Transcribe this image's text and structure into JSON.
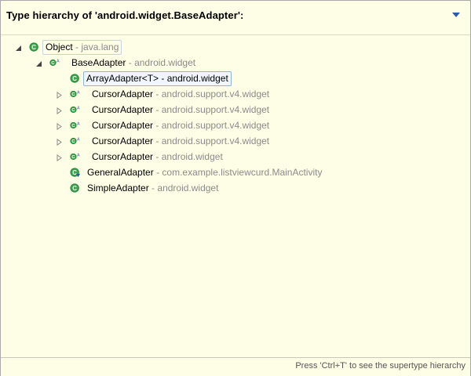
{
  "header": {
    "title": "Type hierarchy of 'android.widget.BaseAdapter':",
    "menu_icon": "chevron-down-icon"
  },
  "tree": [
    {
      "name": "Object",
      "package": "java.lang",
      "sep": " - ",
      "depth": 0,
      "twisty": "expanded",
      "icon": "class-icon",
      "state": "focus"
    },
    {
      "name": "BaseAdapter",
      "package": "android.widget",
      "sep": " - ",
      "depth": 1,
      "twisty": "expanded",
      "icon": "abstract-class-icon",
      "state": ""
    },
    {
      "name": "ArrayAdapter<T>",
      "package": "android.widget",
      "sep": " - ",
      "depth": 2,
      "twisty": "none",
      "icon": "class-icon",
      "state": "selected"
    },
    {
      "name": "CursorAdapter",
      "package": "android.support.v4.widget",
      "sep": " - ",
      "depth": 2,
      "twisty": "collapsed",
      "icon": "abstract-class-icon",
      "state": ""
    },
    {
      "name": "CursorAdapter",
      "package": "android.support.v4.widget",
      "sep": " - ",
      "depth": 2,
      "twisty": "collapsed",
      "icon": "abstract-class-icon",
      "state": ""
    },
    {
      "name": "CursorAdapter",
      "package": "android.support.v4.widget",
      "sep": " - ",
      "depth": 2,
      "twisty": "collapsed",
      "icon": "abstract-class-icon",
      "state": ""
    },
    {
      "name": "CursorAdapter",
      "package": "android.support.v4.widget",
      "sep": " - ",
      "depth": 2,
      "twisty": "collapsed",
      "icon": "abstract-class-icon",
      "state": ""
    },
    {
      "name": "CursorAdapter",
      "package": "android.widget",
      "sep": " - ",
      "depth": 2,
      "twisty": "collapsed",
      "icon": "abstract-class-icon",
      "state": ""
    },
    {
      "name": "GeneralAdapter",
      "package": "com.example.listviewcurd.MainActivity",
      "sep": " - ",
      "depth": 2,
      "twisty": "none",
      "icon": "inner-class-icon",
      "state": ""
    },
    {
      "name": "SimpleAdapter",
      "package": "android.widget",
      "sep": " - ",
      "depth": 2,
      "twisty": "none",
      "icon": "class-icon",
      "state": ""
    }
  ],
  "status": {
    "text": "Press 'Ctrl+T' to see the supertype hierarchy"
  },
  "colors": {
    "background": "#fefee6",
    "class_icon": "#2e8b3e",
    "selection_border": "#8fb4de",
    "package_text": "#8b8b8b"
  }
}
